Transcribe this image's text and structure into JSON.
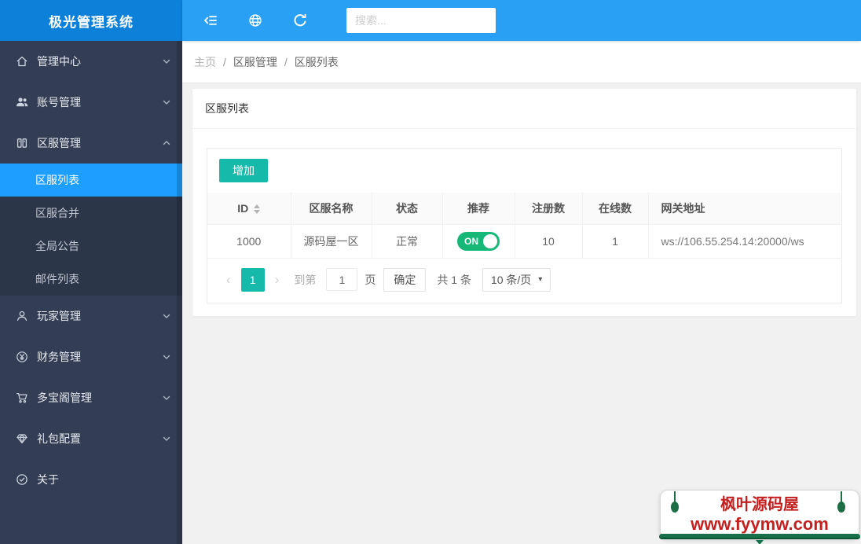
{
  "colors": {
    "header_blue": "#2aa0f5",
    "logo_blue": "#0d80da",
    "sidebar_bg": "#333e54",
    "submenu_bg": "#2b3649",
    "active_item_blue": "#1e9fff",
    "accent_teal": "#16baaa",
    "switch_green": "#16b777",
    "watermark_red": "#c3201f",
    "watermark_green": "#17704a"
  },
  "header": {
    "logo_text": "极光管理系统",
    "search_placeholder": "搜索..."
  },
  "breadcrumb": {
    "separator": "/",
    "items": [
      "主页",
      "区服管理",
      "区服列表"
    ]
  },
  "sidebar": {
    "items": [
      {
        "label": "管理中心",
        "icon": "home-icon"
      },
      {
        "label": "账号管理",
        "icon": "users-icon"
      },
      {
        "label": "区服管理",
        "icon": "server-icon",
        "expanded": true,
        "children": [
          {
            "label": "区服列表",
            "active": true
          },
          {
            "label": "区服合并"
          },
          {
            "label": "全局公告"
          },
          {
            "label": "邮件列表"
          }
        ]
      },
      {
        "label": "玩家管理",
        "icon": "user-icon"
      },
      {
        "label": "财务管理",
        "icon": "yen-circle-icon"
      },
      {
        "label": "多宝阁管理",
        "icon": "cart-icon"
      },
      {
        "label": "礼包配置",
        "icon": "gem-icon"
      },
      {
        "label": "关于",
        "icon": "check-circle-icon"
      }
    ]
  },
  "card": {
    "title": "区服列表",
    "add_button_label": "增加"
  },
  "table": {
    "columns": [
      "ID",
      "区服名称",
      "状态",
      "推荐",
      "注册数",
      "在线数",
      "网关地址"
    ],
    "rows": [
      {
        "id": "1000",
        "name": "源码屋一区",
        "status": "正常",
        "recommend": "ON",
        "registered": "10",
        "online": "1",
        "gateway": "ws://106.55.254.14:20000/ws"
      }
    ]
  },
  "pagination": {
    "current_page": "1",
    "goto_label": "到第",
    "page_input": "1",
    "page_unit": "页",
    "confirm_label": "确定",
    "total_label": "共 1 条",
    "page_size_label": "10 条/页"
  },
  "watermark": {
    "line1": "枫叶源码屋",
    "line2": "www.fyymw.com"
  }
}
